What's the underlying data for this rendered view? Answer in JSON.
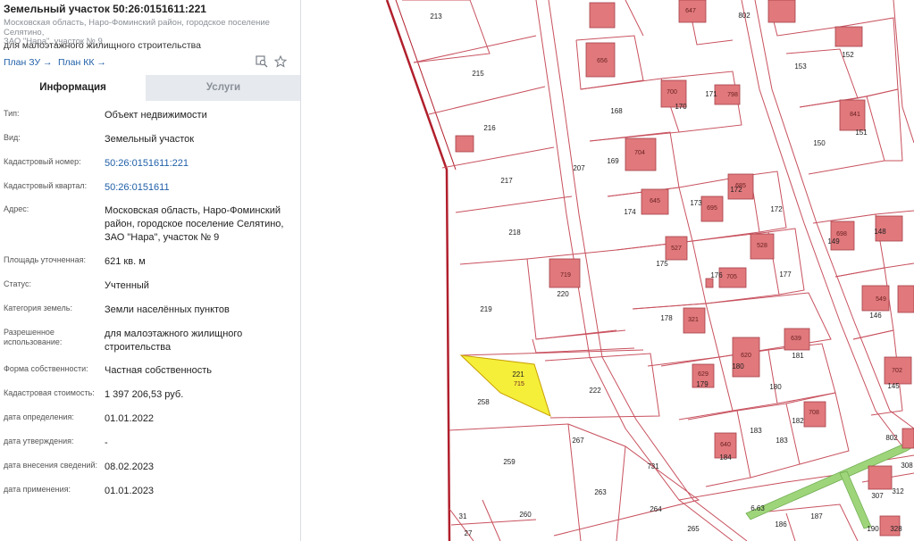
{
  "panel": {
    "title": "Земельный участок 50:26:0151611:221",
    "address_small_line1": "Московская область, Наро-Фоминский район, городское поселение Селятино,",
    "address_small_line2": "ЗАО \"Нара\", участок № 9",
    "purpose": "для малоэтажного жилищного строительства",
    "links": {
      "plan_zu": "План ЗУ →",
      "plan_kk": "План КК →"
    },
    "icons": [
      "map-search-icon",
      "star-icon"
    ],
    "tabs": {
      "info": "Информация",
      "services": "Услуги"
    },
    "fields": [
      {
        "label": "Тип:",
        "value": "Объект недвижимости"
      },
      {
        "label": "Вид:",
        "value": "Земельный участок"
      },
      {
        "label": "Кадастровый номер:",
        "value": "50:26:0151611:221",
        "link": true
      },
      {
        "label": "Кадастровый квартал:",
        "value": "50:26:0151611",
        "link": true
      },
      {
        "label": "Адрес:",
        "value": "Московская область, Наро-Фоминский район, городское поселение Селятино, ЗАО \"Нара\", участок № 9"
      },
      {
        "label": "Площадь уточненная:",
        "value": "621 кв. м"
      },
      {
        "label": "Статус:",
        "value": "Учтенный"
      },
      {
        "label": "Категория земель:",
        "value": "Земли населённых пунктов"
      },
      {
        "label": "Разрешенное использование:",
        "value": "для малоэтажного жилищного строительства"
      },
      {
        "label": "Форма собственности:",
        "value": "Частная собственность"
      },
      {
        "label": "Кадастровая стоимость:",
        "value": "1 397 206,53 руб."
      },
      {
        "label": "дата определения:",
        "value": "01.01.2022"
      },
      {
        "label": "дата утверждения:",
        "value": "-"
      },
      {
        "label": "дата внесения сведений:",
        "value": "08.02.2023"
      },
      {
        "label": "дата применения:",
        "value": "01.01.2023"
      }
    ]
  },
  "map": {
    "colors": {
      "boundary": "#c8515e",
      "building": "#e0787c",
      "selected": "#f5ef3a",
      "road_green": "#7fbf5a",
      "thick_border": "#b11f2c"
    },
    "parcels": [
      "213",
      "215",
      "216",
      "217",
      "218",
      "219",
      "220",
      "221",
      "222",
      "258",
      "259",
      "260",
      "263",
      "264",
      "265",
      "267",
      "731",
      "207",
      "168",
      "169",
      "170",
      "171",
      "172",
      "173",
      "174",
      "175",
      "176",
      "177",
      "178",
      "179",
      "180",
      "181",
      "182",
      "183",
      "184",
      "186",
      "187",
      "150",
      "151",
      "152",
      "153",
      "145",
      "146",
      "148",
      "149",
      "190",
      "31",
      "27",
      "802",
      "308",
      "307",
      "312",
      "328",
      "6.63"
    ],
    "buildings": [
      "647",
      "719",
      "715",
      "841",
      "798",
      "704",
      "656",
      "645",
      "685",
      "695",
      "702",
      "708",
      "321",
      "527",
      "528",
      "549",
      "698",
      "705",
      "620",
      "639",
      "640",
      "700",
      "629"
    ]
  }
}
